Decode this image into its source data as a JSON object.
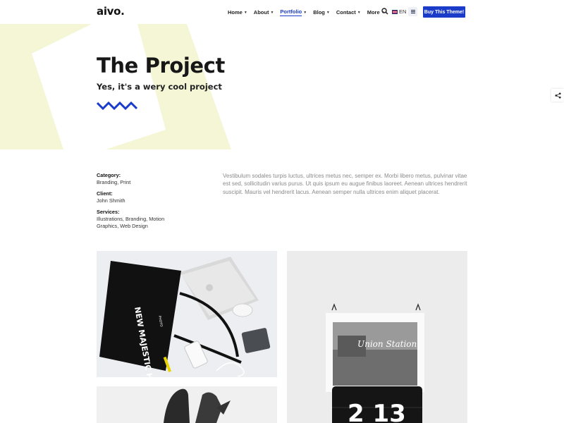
{
  "header": {
    "logo": "aivo.",
    "nav": [
      {
        "label": "Home",
        "active": false
      },
      {
        "label": "About",
        "active": false
      },
      {
        "label": "Portfolio",
        "active": true
      },
      {
        "label": "Blog",
        "active": false
      },
      {
        "label": "Contact",
        "active": false
      },
      {
        "label": "More",
        "active": false
      }
    ],
    "language": "EN",
    "cta_label": "Buy This Theme!",
    "accent_color": "#1a3cc8"
  },
  "hero": {
    "title": "The Project",
    "subtitle": "Yes, it's a wery cool project",
    "decor_color": "#f4f6d6"
  },
  "meta": {
    "category_label": "Category:",
    "category_value": "Branding, Print",
    "client_label": "Client:",
    "client_value": "John Shmith",
    "services_label": "Services:",
    "services_value": "Illustrations, Branding, Motion Graphics, Web Design"
  },
  "description": "Vestibulum sodales turpis luctus, ultrices metus nec, semper ex. Morbi libero metus, pulvinar vitae est sed, sollicitudin varius purus. Ut quis ipsum eu augue finibus laoreet. Aenean ultrices hendrerit suscipit. Mauris vel hendrerit lacus. Aenean semper nulla ultrices enim aliquet placerat.",
  "gallery": {
    "image1": {
      "bag_text": "NEW MAJESTIC HOTEL",
      "bag_small": "PHOTO"
    },
    "image2": {
      "poster_text": "Union Station",
      "clock_text": "2 13"
    }
  },
  "icons": {
    "search": "search-icon",
    "menu": "hamburger-icon",
    "share": "share-icon",
    "flag": "uk-flag-icon"
  }
}
